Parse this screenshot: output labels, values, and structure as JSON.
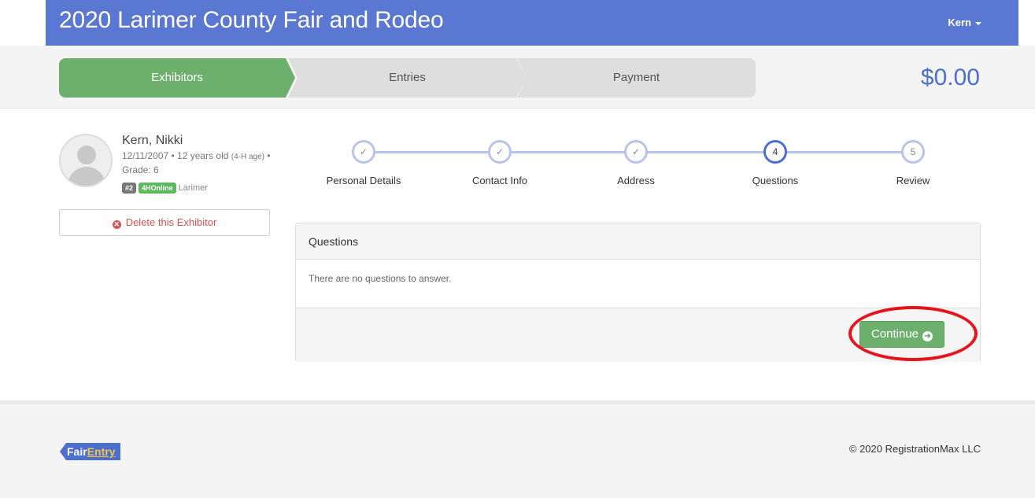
{
  "header": {
    "title": "2020 Larimer County Fair and Rodeo",
    "user": "Kern"
  },
  "progress": {
    "steps": [
      {
        "label": "Exhibitors",
        "state": "active"
      },
      {
        "label": "Entries",
        "state": "inactive"
      },
      {
        "label": "Payment",
        "state": "inactive"
      }
    ],
    "total": "$0.00"
  },
  "exhibitor": {
    "name": "Kern, Nikki",
    "birthdate": "12/11/2007",
    "age_text": "12 years old",
    "age_note": "(4-H age)",
    "grade": "Grade: 6",
    "badge_number": "#2",
    "badge_source": "4HOnline",
    "county": "Larimer",
    "delete_label": "Delete this Exhibitor"
  },
  "wizard": {
    "steps": [
      {
        "label": "Personal Details",
        "marker": "✓",
        "state": "done"
      },
      {
        "label": "Contact Info",
        "marker": "✓",
        "state": "done"
      },
      {
        "label": "Address",
        "marker": "✓",
        "state": "done"
      },
      {
        "label": "Questions",
        "marker": "4",
        "state": "active"
      },
      {
        "label": "Review",
        "marker": "5",
        "state": "pending"
      }
    ]
  },
  "questions": {
    "heading": "Questions",
    "empty_message": "There are no questions to answer.",
    "continue_label": "Continue"
  },
  "footer": {
    "logo_part1": "Fair",
    "logo_part2": "Entry",
    "copyright": "© 2020 RegistrationMax LLC"
  },
  "colors": {
    "header": "#5a77d1",
    "active_step": "#6db06d",
    "inactive_step": "#dedede",
    "accent": "#4a6fd0",
    "delete": "#d9534f",
    "highlight_ring": "#e3151b"
  }
}
